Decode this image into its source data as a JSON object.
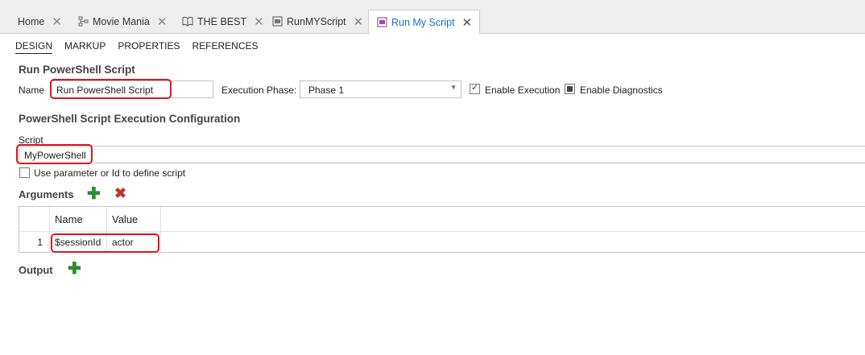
{
  "tabs": [
    {
      "label": "Home",
      "icon": "",
      "active": false
    },
    {
      "label": "Movie Mania",
      "icon": "diagram-icon",
      "active": false
    },
    {
      "label": "THE BEST",
      "icon": "book-icon",
      "active": false
    },
    {
      "label": "RunMYScript",
      "icon": "script-icon",
      "active": false
    },
    {
      "label": "Run My Script",
      "icon": "script-icon",
      "active": true
    }
  ],
  "close_glyph": "✕",
  "subtabs": [
    "DESIGN",
    "MARKUP",
    "PROPERTIES",
    "REFERENCES"
  ],
  "section1": {
    "title": "Run PowerShell Script",
    "name_label": "Name",
    "name_value": "Run PowerShell Script",
    "phase_label": "Execution Phase:",
    "phase_value": "Phase 1",
    "enable_execution": {
      "label": "Enable Execution",
      "checked": true
    },
    "enable_diagnostics": {
      "label": "Enable Diagnostics",
      "checked": false
    }
  },
  "section2": {
    "title": "PowerShell Script Execution Configuration",
    "script_label": "Script",
    "script_value": "MyPowerShell",
    "use_param_label": "Use parameter or Id to define script"
  },
  "arguments": {
    "title": "Arguments",
    "columns": [
      "Name",
      "Value"
    ],
    "rows": [
      {
        "num": "1",
        "name": "$sessionId",
        "value": "actor"
      }
    ]
  },
  "output": {
    "title": "Output"
  },
  "colors": {
    "accent": "#1a6fc4",
    "highlight": "#e0161b",
    "add_green": "#2e8b2e",
    "delete_red": "#c0392b"
  }
}
